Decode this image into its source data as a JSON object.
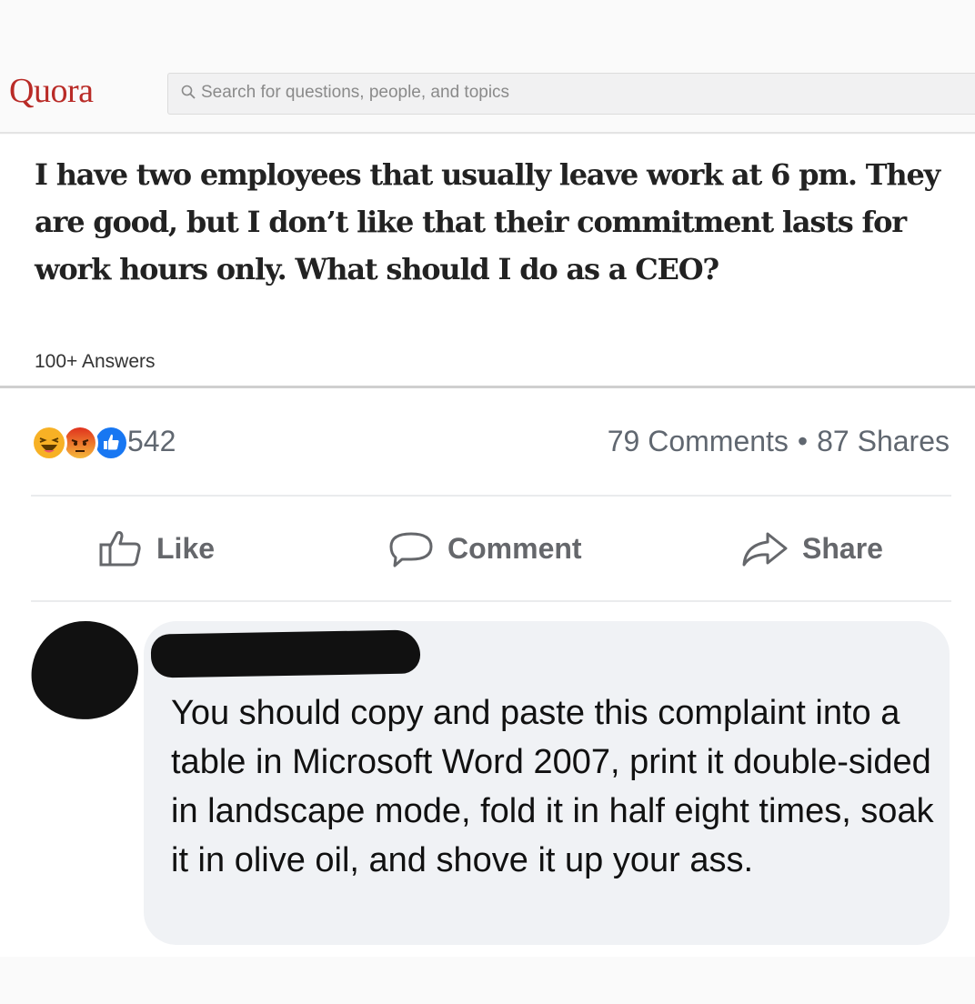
{
  "quora": {
    "logo": "Quora",
    "search": {
      "placeholder": "Search for questions, people, and topics",
      "icon": "search-icon"
    },
    "question": {
      "title": "I have two employees that usually leave work at 6 pm. They are good, but I don’t like that their commitment lasts for work hours only. What should I do as a CEO?",
      "answers_label": "100+ Answers"
    },
    "brand_color": "#b92b27"
  },
  "post": {
    "reactions": {
      "icons": [
        "haha-icon",
        "angry-icon",
        "like-icon"
      ],
      "count": "542"
    },
    "comments_label": "79 Comments",
    "separator": "•",
    "shares_label": "87 Shares",
    "actions": {
      "like_label": "Like",
      "comment_label": "Comment",
      "share_label": "Share"
    },
    "comment": {
      "text": "You should copy and paste this complaint into a table in Microsoft Word 2007, print it double-sided in landscape mode, fold it in half eight times, soak it in olive oil, and shove it up your ass."
    },
    "colors": {
      "like_blue": "#1877f2",
      "haha_yellow": "#f7b125",
      "angry_orange": "#e9710f",
      "muted_text": "#65676b",
      "bubble_bg": "#f0f2f5"
    }
  }
}
